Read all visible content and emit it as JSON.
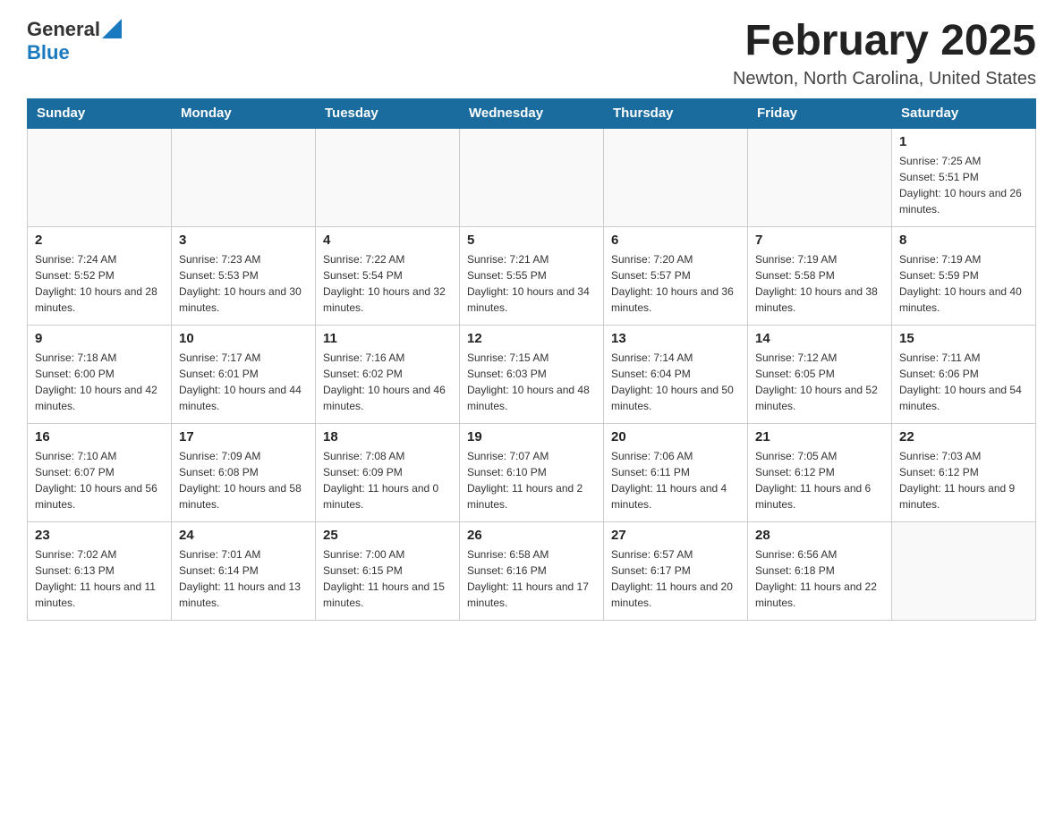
{
  "header": {
    "logo_general": "General",
    "logo_blue": "Blue",
    "month_title": "February 2025",
    "location": "Newton, North Carolina, United States"
  },
  "days_of_week": [
    "Sunday",
    "Monday",
    "Tuesday",
    "Wednesday",
    "Thursday",
    "Friday",
    "Saturday"
  ],
  "weeks": [
    {
      "cells": [
        {
          "day": "",
          "info": ""
        },
        {
          "day": "",
          "info": ""
        },
        {
          "day": "",
          "info": ""
        },
        {
          "day": "",
          "info": ""
        },
        {
          "day": "",
          "info": ""
        },
        {
          "day": "",
          "info": ""
        },
        {
          "day": "1",
          "info": "Sunrise: 7:25 AM\nSunset: 5:51 PM\nDaylight: 10 hours and 26 minutes."
        }
      ]
    },
    {
      "cells": [
        {
          "day": "2",
          "info": "Sunrise: 7:24 AM\nSunset: 5:52 PM\nDaylight: 10 hours and 28 minutes."
        },
        {
          "day": "3",
          "info": "Sunrise: 7:23 AM\nSunset: 5:53 PM\nDaylight: 10 hours and 30 minutes."
        },
        {
          "day": "4",
          "info": "Sunrise: 7:22 AM\nSunset: 5:54 PM\nDaylight: 10 hours and 32 minutes."
        },
        {
          "day": "5",
          "info": "Sunrise: 7:21 AM\nSunset: 5:55 PM\nDaylight: 10 hours and 34 minutes."
        },
        {
          "day": "6",
          "info": "Sunrise: 7:20 AM\nSunset: 5:57 PM\nDaylight: 10 hours and 36 minutes."
        },
        {
          "day": "7",
          "info": "Sunrise: 7:19 AM\nSunset: 5:58 PM\nDaylight: 10 hours and 38 minutes."
        },
        {
          "day": "8",
          "info": "Sunrise: 7:19 AM\nSunset: 5:59 PM\nDaylight: 10 hours and 40 minutes."
        }
      ]
    },
    {
      "cells": [
        {
          "day": "9",
          "info": "Sunrise: 7:18 AM\nSunset: 6:00 PM\nDaylight: 10 hours and 42 minutes."
        },
        {
          "day": "10",
          "info": "Sunrise: 7:17 AM\nSunset: 6:01 PM\nDaylight: 10 hours and 44 minutes."
        },
        {
          "day": "11",
          "info": "Sunrise: 7:16 AM\nSunset: 6:02 PM\nDaylight: 10 hours and 46 minutes."
        },
        {
          "day": "12",
          "info": "Sunrise: 7:15 AM\nSunset: 6:03 PM\nDaylight: 10 hours and 48 minutes."
        },
        {
          "day": "13",
          "info": "Sunrise: 7:14 AM\nSunset: 6:04 PM\nDaylight: 10 hours and 50 minutes."
        },
        {
          "day": "14",
          "info": "Sunrise: 7:12 AM\nSunset: 6:05 PM\nDaylight: 10 hours and 52 minutes."
        },
        {
          "day": "15",
          "info": "Sunrise: 7:11 AM\nSunset: 6:06 PM\nDaylight: 10 hours and 54 minutes."
        }
      ]
    },
    {
      "cells": [
        {
          "day": "16",
          "info": "Sunrise: 7:10 AM\nSunset: 6:07 PM\nDaylight: 10 hours and 56 minutes."
        },
        {
          "day": "17",
          "info": "Sunrise: 7:09 AM\nSunset: 6:08 PM\nDaylight: 10 hours and 58 minutes."
        },
        {
          "day": "18",
          "info": "Sunrise: 7:08 AM\nSunset: 6:09 PM\nDaylight: 11 hours and 0 minutes."
        },
        {
          "day": "19",
          "info": "Sunrise: 7:07 AM\nSunset: 6:10 PM\nDaylight: 11 hours and 2 minutes."
        },
        {
          "day": "20",
          "info": "Sunrise: 7:06 AM\nSunset: 6:11 PM\nDaylight: 11 hours and 4 minutes."
        },
        {
          "day": "21",
          "info": "Sunrise: 7:05 AM\nSunset: 6:12 PM\nDaylight: 11 hours and 6 minutes."
        },
        {
          "day": "22",
          "info": "Sunrise: 7:03 AM\nSunset: 6:12 PM\nDaylight: 11 hours and 9 minutes."
        }
      ]
    },
    {
      "cells": [
        {
          "day": "23",
          "info": "Sunrise: 7:02 AM\nSunset: 6:13 PM\nDaylight: 11 hours and 11 minutes."
        },
        {
          "day": "24",
          "info": "Sunrise: 7:01 AM\nSunset: 6:14 PM\nDaylight: 11 hours and 13 minutes."
        },
        {
          "day": "25",
          "info": "Sunrise: 7:00 AM\nSunset: 6:15 PM\nDaylight: 11 hours and 15 minutes."
        },
        {
          "day": "26",
          "info": "Sunrise: 6:58 AM\nSunset: 6:16 PM\nDaylight: 11 hours and 17 minutes."
        },
        {
          "day": "27",
          "info": "Sunrise: 6:57 AM\nSunset: 6:17 PM\nDaylight: 11 hours and 20 minutes."
        },
        {
          "day": "28",
          "info": "Sunrise: 6:56 AM\nSunset: 6:18 PM\nDaylight: 11 hours and 22 minutes."
        },
        {
          "day": "",
          "info": ""
        }
      ]
    }
  ]
}
